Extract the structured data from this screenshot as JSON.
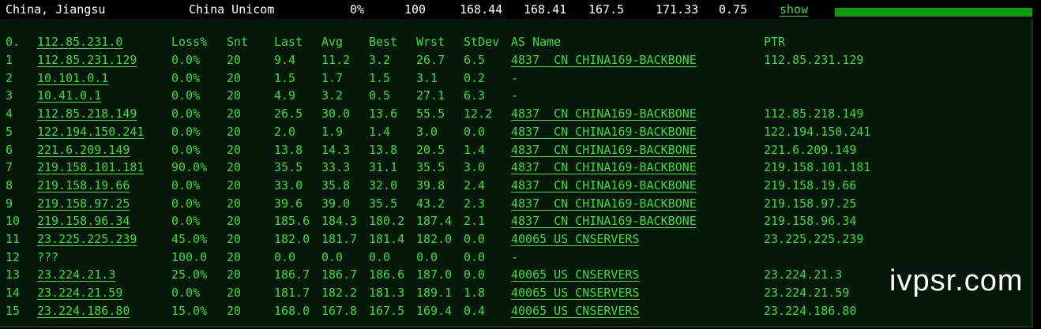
{
  "header": {
    "location": "China, Jiangsu",
    "isp": "China Unicom",
    "loss": "0%",
    "sent": "100",
    "last": "168.44",
    "avg": "168.41",
    "best": "167.5",
    "worst": "171.33",
    "stdev": "0.75",
    "show_label": "show"
  },
  "columns": {
    "hop": "0.",
    "host": "112.85.231.0",
    "loss": "Loss%",
    "snt": "Snt",
    "last": "Last",
    "avg": "Avg",
    "best": "Best",
    "wrst": "Wrst",
    "stdev": "StDev",
    "as": "AS Name",
    "ptr": "PTR"
  },
  "hops": [
    {
      "hop": "1",
      "host": "112.85.231.129",
      "loss": "0.0%",
      "snt": "20",
      "last": "9.4",
      "avg": "11.2",
      "best": "3.2",
      "wrst": "26.7",
      "stdev": "6.5",
      "as": "4837  CN CHINA169-BACKBONE",
      "ptr": "112.85.231.129"
    },
    {
      "hop": "2",
      "host": "10.101.0.1",
      "loss": "0.0%",
      "snt": "20",
      "last": "1.5",
      "avg": "1.7",
      "best": "1.5",
      "wrst": "3.1",
      "stdev": "0.2",
      "as": "-",
      "ptr": ""
    },
    {
      "hop": "3",
      "host": "10.41.0.1",
      "loss": "0.0%",
      "snt": "20",
      "last": "4.9",
      "avg": "3.2",
      "best": "0.5",
      "wrst": "27.1",
      "stdev": "6.3",
      "as": "-",
      "ptr": ""
    },
    {
      "hop": "4",
      "host": "112.85.218.149",
      "loss": "0.0%",
      "snt": "20",
      "last": "26.5",
      "avg": "30.0",
      "best": "13.6",
      "wrst": "55.5",
      "stdev": "12.2",
      "as": "4837  CN CHINA169-BACKBONE",
      "ptr": "112.85.218.149"
    },
    {
      "hop": "5",
      "host": "122.194.150.241",
      "loss": "0.0%",
      "snt": "20",
      "last": "2.0",
      "avg": "1.9",
      "best": "1.4",
      "wrst": "3.0",
      "stdev": "0.0",
      "as": "4837  CN CHINA169-BACKBONE",
      "ptr": "122.194.150.241"
    },
    {
      "hop": "6",
      "host": "221.6.209.149",
      "loss": "0.0%",
      "snt": "20",
      "last": "13.8",
      "avg": "14.3",
      "best": "13.8",
      "wrst": "20.5",
      "stdev": "1.4",
      "as": "4837  CN CHINA169-BACKBONE",
      "ptr": "221.6.209.149"
    },
    {
      "hop": "7",
      "host": "219.158.101.181",
      "loss": "90.0%",
      "snt": "20",
      "last": "35.5",
      "avg": "33.3",
      "best": "31.1",
      "wrst": "35.5",
      "stdev": "3.0",
      "as": "4837  CN CHINA169-BACKBONE",
      "ptr": "219.158.101.181"
    },
    {
      "hop": "8",
      "host": "219.158.19.66",
      "loss": "0.0%",
      "snt": "20",
      "last": "33.0",
      "avg": "35.8",
      "best": "32.0",
      "wrst": "39.8",
      "stdev": "2.4",
      "as": "4837  CN CHINA169-BACKBONE",
      "ptr": "219.158.19.66"
    },
    {
      "hop": "9",
      "host": "219.158.97.25",
      "loss": "0.0%",
      "snt": "20",
      "last": "39.6",
      "avg": "39.0",
      "best": "35.5",
      "wrst": "43.2",
      "stdev": "2.3",
      "as": "4837  CN CHINA169-BACKBONE",
      "ptr": "219.158.97.25"
    },
    {
      "hop": "10",
      "host": "219.158.96.34",
      "loss": "0.0%",
      "snt": "20",
      "last": "185.6",
      "avg": "184.3",
      "best": "180.2",
      "wrst": "187.4",
      "stdev": "2.1",
      "as": "4837  CN CHINA169-BACKBONE",
      "ptr": "219.158.96.34"
    },
    {
      "hop": "11",
      "host": "23.225.225.239",
      "loss": "45.0%",
      "snt": "20",
      "last": "182.0",
      "avg": "181.7",
      "best": "181.4",
      "wrst": "182.0",
      "stdev": "0.0",
      "as": "40065 US CNSERVERS",
      "ptr": "23.225.225.239"
    },
    {
      "hop": "12",
      "host": "???",
      "loss": "100.0",
      "snt": "20",
      "last": "0.0",
      "avg": "0.0",
      "best": "0.0",
      "wrst": "0.0",
      "stdev": "0.0",
      "as": "-",
      "ptr": ""
    },
    {
      "hop": "13",
      "host": "23.224.21.3",
      "loss": "25.0%",
      "snt": "20",
      "last": "186.7",
      "avg": "186.7",
      "best": "186.6",
      "wrst": "187.0",
      "stdev": "0.0",
      "as": "40065 US CNSERVERS",
      "ptr": "23.224.21.3"
    },
    {
      "hop": "14",
      "host": "23.224.21.59",
      "loss": "0.0%",
      "snt": "20",
      "last": "181.7",
      "avg": "182.2",
      "best": "181.3",
      "wrst": "189.1",
      "stdev": "1.8",
      "as": "40065 US CNSERVERS",
      "ptr": "23.224.21.59"
    },
    {
      "hop": "15",
      "host": "23.224.186.80",
      "loss": "15.0%",
      "snt": "20",
      "last": "168.0",
      "avg": "167.8",
      "best": "167.5",
      "wrst": "169.4",
      "stdev": "0.4",
      "as": "40065 US CNSERVERS",
      "ptr": "23.224.186.80"
    }
  ],
  "watermark": "ivpsr.com",
  "colors": {
    "background": "#000000",
    "panel": "#06180a",
    "text_green": "#3ddc3d",
    "text_white": "#ffffff",
    "bar_green": "#0d9a0d"
  }
}
